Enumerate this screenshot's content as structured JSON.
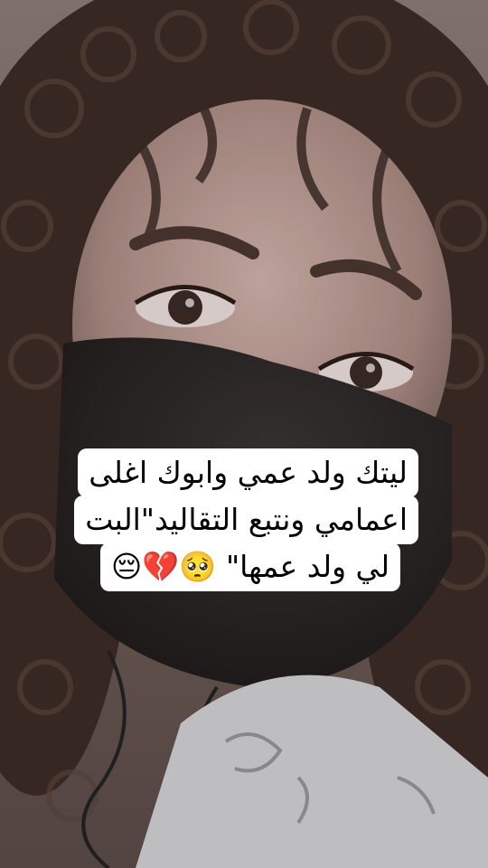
{
  "caption": {
    "lines": [
      "ليتك ولد عمي وابوك اغلى",
      "اعمامي ونتبع التقاليد\"البت",
      "لي ولد عمها\" 🥺💔😔"
    ]
  },
  "colors": {
    "hair": "#3a2a25",
    "skin": "#b89a92",
    "mask": "#2b2626",
    "shirt": "#cfcfd2",
    "caption_bg": "#ffffff"
  }
}
